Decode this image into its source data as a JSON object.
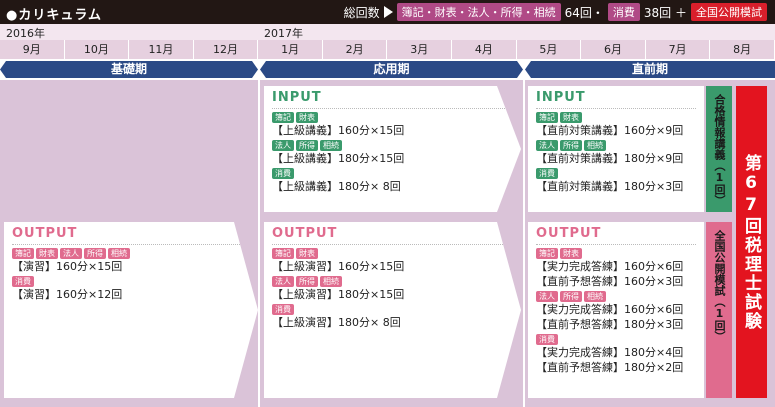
{
  "header": {
    "title": "●カリキュラム",
    "total_label": "総回数",
    "tag1": "簿記・財表・法人・所得・相続",
    "count1": "64回・",
    "tag2": "消費",
    "count2": "38回 ＋",
    "tag3": "全国公開模試"
  },
  "years": {
    "y2016": "2016年",
    "y2017": "2017年"
  },
  "months": [
    "9月",
    "10月",
    "11月",
    "12月",
    "1月",
    "2月",
    "3月",
    "4月",
    "5月",
    "6月",
    "7月",
    "8月"
  ],
  "phases": {
    "a": "基礎期",
    "b": "応用期",
    "c": "直前期"
  },
  "cards": {
    "out1": {
      "head": "OUTPUT",
      "tags1": [
        "簿記",
        "財表",
        "法人",
        "所得",
        "相続"
      ],
      "l1": "【演習】160分×15回",
      "tags2": [
        "消費"
      ],
      "l2": "【演習】160分×12回"
    },
    "in2": {
      "head": "INPUT",
      "tags1": [
        "簿記",
        "財表"
      ],
      "l1": "【上級講義】160分×15回",
      "tags2": [
        "法人",
        "所得",
        "相続"
      ],
      "l2": "【上級講義】180分×15回",
      "tags3": [
        "消費"
      ],
      "l3": "【上級講義】180分× 8回"
    },
    "out2": {
      "head": "OUTPUT",
      "tags1": [
        "簿記",
        "財表"
      ],
      "l1": "【上級演習】160分×15回",
      "tags2": [
        "法人",
        "所得",
        "相続"
      ],
      "l2": "【上級演習】180分×15回",
      "tags3": [
        "消費"
      ],
      "l3": "【上級演習】180分× 8回"
    },
    "in3": {
      "head": "INPUT",
      "tags1": [
        "簿記",
        "財表"
      ],
      "l1": "【直前対策講義】160分×9回",
      "tags2": [
        "法人",
        "所得",
        "相続"
      ],
      "l2": "【直前対策講義】180分×9回",
      "tags3": [
        "消費"
      ],
      "l3": "【直前対策講義】180分×3回"
    },
    "out3": {
      "head": "OUTPUT",
      "tags1": [
        "簿記",
        "財表"
      ],
      "l1a": "【実力完成答練】160分×6回",
      "l1b": "【直前予想答練】160分×3回",
      "tags2": [
        "法人",
        "所得",
        "相続"
      ],
      "l2a": "【実力完成答練】160分×6回",
      "l2b": "【直前予想答練】180分×3回",
      "tags3": [
        "消費"
      ],
      "l3a": "【実力完成答練】180分×4回",
      "l3b": "【直前予想答練】180分×2回"
    }
  },
  "vboxes": {
    "green": "合格情報講義（1回）",
    "pink": "全国公開模試（1回）",
    "red": "第67回税理士試験"
  }
}
